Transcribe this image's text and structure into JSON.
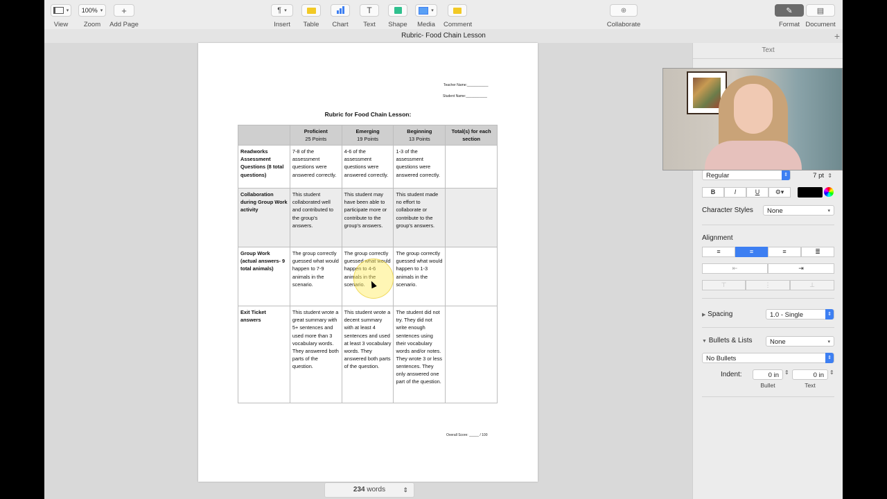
{
  "toolbar": {
    "view_label": "View",
    "zoom_value": "100%",
    "zoom_label": "Zoom",
    "add_page_label": "Add Page",
    "insert_label": "Insert",
    "table_label": "Table",
    "chart_label": "Chart",
    "text_label": "Text",
    "shape_label": "Shape",
    "media_label": "Media",
    "comment_label": "Comment",
    "collaborate_label": "Collaborate",
    "format_label": "Format",
    "document_label": "Document"
  },
  "window": {
    "title": "Rubric- Food Chain Lesson"
  },
  "document": {
    "teacher_name": "Teacher Name:___________",
    "student_name": "Student Name:___________",
    "title": "Rubric for Food Chain Lesson:",
    "headers": [
      {
        "name": "Proficient",
        "points": "25 Points"
      },
      {
        "name": "Emerging",
        "points": "19 Points"
      },
      {
        "name": "Beginning",
        "points": "13 Points"
      },
      {
        "name": "Total(s) for each section",
        "points": ""
      }
    ],
    "rows": [
      {
        "criterion": "Readworks Assessment Questions (8 total questions)",
        "proficient": "7-8 of the assessment questions were answered correctly.",
        "emerging": "4-6 of the assessment questions were answered correctly.",
        "beginning": "1-3 of the assessment questions were answered correctly."
      },
      {
        "criterion": "Collaboration during Group Work activity",
        "proficient": "This student collaborated well and contributed to the group's answers.",
        "emerging": "This student may have been able to participate more or contribute to the group's answers.",
        "beginning": "This student made no effort to collaborate or contribute to the group's answers."
      },
      {
        "criterion": "Group Work (actual answers- 9 total animals)",
        "proficient": "The group correctly guessed what would happen to 7-9 animals in the scenario.",
        "emerging": "The group correctly guessed what would happen to 4-6 animals in the scenario.",
        "beginning": "The group correctly guessed what would happen to 1-3 animals in the scenario."
      },
      {
        "criterion": "Exit Ticket answers",
        "proficient": "This student wrote a great summary with 5+ sentences and used more than 3 vocabulary words. They answered both parts of the question.",
        "emerging": "This student wrote a decent summary with at least 4 sentences and used at least 3 vocabulary words. They answered both parts of the question.",
        "beginning": "The student did not try. They did not write enough sentences using their vocabulary words and/or notes. They wrote 3 or less sentences. They only answered one part of the question."
      }
    ],
    "overall_score": "Overall Score: _____ / 100"
  },
  "status": {
    "word_count": "234",
    "word_label": "words"
  },
  "sidebar": {
    "header": "Text",
    "font_style": "Regular",
    "font_size": "7 pt",
    "bold": "B",
    "italic": "I",
    "underline": "U",
    "character_styles_label": "Character Styles",
    "character_styles_value": "None",
    "alignment_label": "Alignment",
    "spacing_label": "Spacing",
    "spacing_value": "1.0 - Single",
    "bullets_label": "Bullets & Lists",
    "bullets_value": "None",
    "bullets_style": "No Bullets",
    "indent_label": "Indent:",
    "indent_bullet_value": "0 in",
    "indent_text_value": "0 in",
    "bullet_caption": "Bullet",
    "text_caption": "Text"
  },
  "colors": {
    "accent": "#3d7ff2",
    "text_color_swatch": "#000000"
  }
}
